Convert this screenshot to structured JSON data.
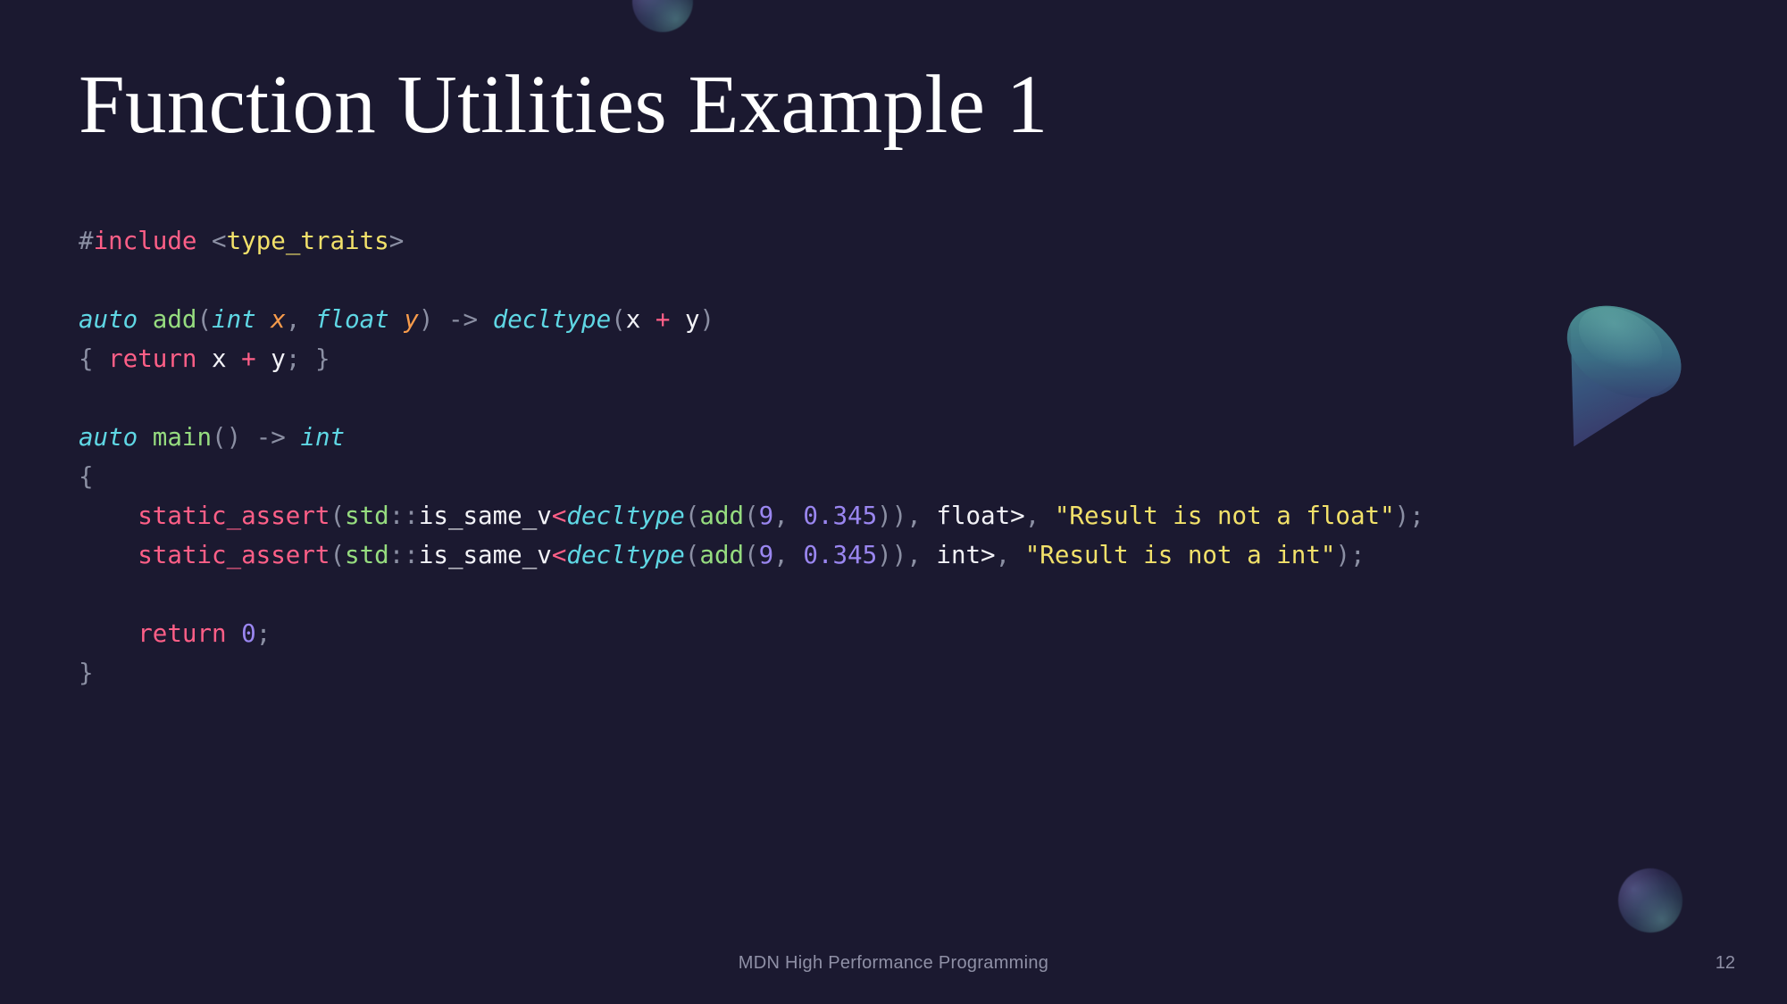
{
  "slide": {
    "title": "Function Utilities Example 1",
    "background_color": "#1b1930",
    "footer": "MDN High Performance Programming",
    "page_number": "12"
  },
  "decorations": [
    {
      "name": "sphere-top",
      "shape": "sphere"
    },
    {
      "name": "cone",
      "shape": "cone"
    },
    {
      "name": "sphere-bottom",
      "shape": "sphere"
    }
  ],
  "code": {
    "language": "cpp",
    "lines": [
      {
        "id": "l1",
        "tokens": [
          {
            "t": "#",
            "c": "punct"
          },
          {
            "t": "include",
            "c": "macro"
          },
          {
            "t": " ",
            "c": "punct"
          },
          {
            "t": "<",
            "c": "punct"
          },
          {
            "t": "type_traits",
            "c": "str"
          },
          {
            "t": ">",
            "c": "punct"
          }
        ]
      },
      {
        "id": "l2",
        "tokens": []
      },
      {
        "id": "l3",
        "tokens": [
          {
            "t": "auto",
            "c": "type"
          },
          {
            "t": " ",
            "c": "plain"
          },
          {
            "t": "add",
            "c": "fn"
          },
          {
            "t": "(",
            "c": "punct"
          },
          {
            "t": "int",
            "c": "type"
          },
          {
            "t": " ",
            "c": "plain"
          },
          {
            "t": "x",
            "c": "param"
          },
          {
            "t": ", ",
            "c": "punct"
          },
          {
            "t": "float",
            "c": "type"
          },
          {
            "t": " ",
            "c": "plain"
          },
          {
            "t": "y",
            "c": "param"
          },
          {
            "t": ")",
            "c": "punct"
          },
          {
            "t": " ",
            "c": "plain"
          },
          {
            "t": "->",
            "c": "punct"
          },
          {
            "t": " ",
            "c": "plain"
          },
          {
            "t": "decltype",
            "c": "type"
          },
          {
            "t": "(",
            "c": "punct"
          },
          {
            "t": "x",
            "c": "plain"
          },
          {
            "t": " ",
            "c": "plain"
          },
          {
            "t": "+",
            "c": "op"
          },
          {
            "t": " ",
            "c": "plain"
          },
          {
            "t": "y",
            "c": "plain"
          },
          {
            "t": ")",
            "c": "punct"
          }
        ]
      },
      {
        "id": "l4",
        "tokens": [
          {
            "t": "{",
            "c": "punct"
          },
          {
            "t": " ",
            "c": "plain"
          },
          {
            "t": "return",
            "c": "kw"
          },
          {
            "t": " ",
            "c": "plain"
          },
          {
            "t": "x",
            "c": "plain"
          },
          {
            "t": " ",
            "c": "plain"
          },
          {
            "t": "+",
            "c": "op"
          },
          {
            "t": " ",
            "c": "plain"
          },
          {
            "t": "y",
            "c": "plain"
          },
          {
            "t": ";",
            "c": "punct"
          },
          {
            "t": " ",
            "c": "plain"
          },
          {
            "t": "}",
            "c": "punct"
          }
        ]
      },
      {
        "id": "l5",
        "tokens": []
      },
      {
        "id": "l6",
        "tokens": [
          {
            "t": "auto",
            "c": "type"
          },
          {
            "t": " ",
            "c": "plain"
          },
          {
            "t": "main",
            "c": "fn"
          },
          {
            "t": "()",
            "c": "punct"
          },
          {
            "t": " ",
            "c": "plain"
          },
          {
            "t": "->",
            "c": "punct"
          },
          {
            "t": " ",
            "c": "plain"
          },
          {
            "t": "int",
            "c": "type"
          }
        ]
      },
      {
        "id": "l7",
        "tokens": [
          {
            "t": "{",
            "c": "punct"
          }
        ]
      },
      {
        "id": "l8",
        "tokens": [
          {
            "t": "    ",
            "c": "plain"
          },
          {
            "t": "static_assert",
            "c": "kw"
          },
          {
            "t": "(",
            "c": "punct"
          },
          {
            "t": "std",
            "c": "ns"
          },
          {
            "t": "::",
            "c": "punct"
          },
          {
            "t": "is_same_v",
            "c": "plain"
          },
          {
            "t": "<",
            "c": "op"
          },
          {
            "t": "decltype",
            "c": "type"
          },
          {
            "t": "(",
            "c": "punct"
          },
          {
            "t": "add",
            "c": "fn"
          },
          {
            "t": "(",
            "c": "punct"
          },
          {
            "t": "9",
            "c": "num"
          },
          {
            "t": ", ",
            "c": "punct"
          },
          {
            "t": "0.345",
            "c": "num"
          },
          {
            "t": "))",
            "c": "punct"
          },
          {
            "t": ", ",
            "c": "punct"
          },
          {
            "t": "float>",
            "c": "plain"
          },
          {
            "t": ", ",
            "c": "punct"
          },
          {
            "t": "\"Result is not a float\"",
            "c": "str"
          },
          {
            "t": ");",
            "c": "punct"
          }
        ]
      },
      {
        "id": "l9",
        "tokens": [
          {
            "t": "    ",
            "c": "plain"
          },
          {
            "t": "static_assert",
            "c": "kw"
          },
          {
            "t": "(",
            "c": "punct"
          },
          {
            "t": "std",
            "c": "ns"
          },
          {
            "t": "::",
            "c": "punct"
          },
          {
            "t": "is_same_v",
            "c": "plain"
          },
          {
            "t": "<",
            "c": "op"
          },
          {
            "t": "decltype",
            "c": "type"
          },
          {
            "t": "(",
            "c": "punct"
          },
          {
            "t": "add",
            "c": "fn"
          },
          {
            "t": "(",
            "c": "punct"
          },
          {
            "t": "9",
            "c": "num"
          },
          {
            "t": ", ",
            "c": "punct"
          },
          {
            "t": "0.345",
            "c": "num"
          },
          {
            "t": "))",
            "c": "punct"
          },
          {
            "t": ", ",
            "c": "punct"
          },
          {
            "t": "int>",
            "c": "plain"
          },
          {
            "t": ", ",
            "c": "punct"
          },
          {
            "t": "\"Result is not a int\"",
            "c": "str"
          },
          {
            "t": ");",
            "c": "punct"
          }
        ]
      },
      {
        "id": "l10",
        "tokens": []
      },
      {
        "id": "l11",
        "tokens": [
          {
            "t": "    ",
            "c": "plain"
          },
          {
            "t": "return",
            "c": "kw"
          },
          {
            "t": " ",
            "c": "plain"
          },
          {
            "t": "0",
            "c": "num"
          },
          {
            "t": ";",
            "c": "punct"
          }
        ]
      },
      {
        "id": "l12",
        "tokens": [
          {
            "t": "}",
            "c": "punct"
          }
        ]
      }
    ]
  },
  "colors": {
    "background": "#1b1930",
    "title": "#ffffff",
    "footer": "#8f90a6",
    "punct": "#8b8fa3",
    "keyword": "#ff5f87",
    "type": "#5fd7e4",
    "function": "#96dc7f",
    "param": "#f79b4b",
    "plain": "#f2f2f7",
    "string": "#f2e16a",
    "number": "#9a86f0"
  }
}
